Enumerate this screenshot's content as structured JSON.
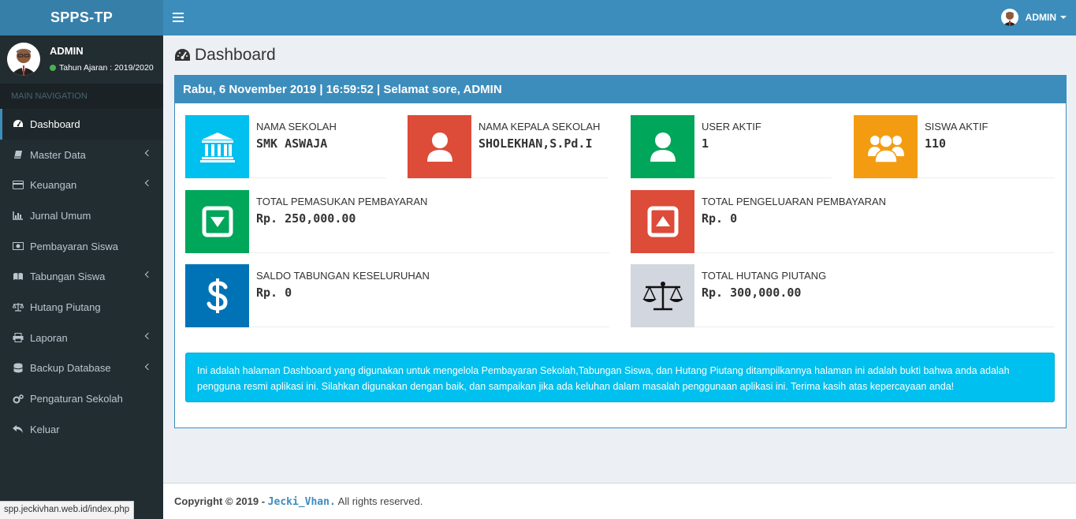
{
  "app": {
    "title": "SPPS-TP"
  },
  "header": {
    "user_label": "ADMIN"
  },
  "sidebar": {
    "user": {
      "name": "ADMIN",
      "year": "Tahun Ajaran : 2019/2020"
    },
    "nav_header": "MAIN NAVIGATION",
    "items": [
      {
        "label": "Dashboard",
        "icon": "dashboard-icon"
      },
      {
        "label": "Master Data",
        "icon": "book-icon"
      },
      {
        "label": "Keuangan",
        "icon": "credit-card-icon"
      },
      {
        "label": "Jurnal Umum",
        "icon": "bar-chart-icon"
      },
      {
        "label": "Pembayaran Siswa",
        "icon": "money-icon"
      },
      {
        "label": "Tabungan Siswa",
        "icon": "open-book-icon"
      },
      {
        "label": "Hutang Piutang",
        "icon": "balance-scale-icon"
      },
      {
        "label": "Laporan",
        "icon": "print-icon"
      },
      {
        "label": "Backup Database",
        "icon": "database-icon"
      },
      {
        "label": "Pengaturan Sekolah",
        "icon": "gears-icon"
      },
      {
        "label": "Keluar",
        "icon": "reply-icon"
      }
    ]
  },
  "page": {
    "title": "Dashboard",
    "box_header": "Rabu, 6 November 2019 | 16:59:52 | Selamat sore, ADMIN"
  },
  "cards": {
    "nama_sekolah": {
      "label": "NAMA SEKOLAH",
      "value": "SMK ASWAJA",
      "color": "#00c0ef"
    },
    "kepala_sekolah": {
      "label": "NAMA KEPALA SEKOLAH",
      "value": "SHOLEKHAN,S.Pd.I",
      "color": "#dd4b39"
    },
    "user_aktif": {
      "label": "USER AKTIF",
      "value": "1",
      "color": "#00a65a"
    },
    "siswa_aktif": {
      "label": "SISWA AKTIF",
      "value": "110",
      "color": "#f39c12"
    },
    "pemasukan": {
      "label": "TOTAL PEMASUKAN PEMBAYARAN",
      "value": "Rp. 250,000.00",
      "color": "#00a65a"
    },
    "pengeluaran": {
      "label": "TOTAL PENGELUARAN PEMBAYARAN",
      "value": "Rp. 0",
      "color": "#dd4b39"
    },
    "tabungan": {
      "label": "SALDO TABUNGAN KESELURUHAN",
      "value": "Rp. 0",
      "color": "#0073b7"
    },
    "hutang": {
      "label": "TOTAL HUTANG PIUTANG",
      "value": "Rp. 300,000.00",
      "color": "#d2d6de"
    }
  },
  "callout": "Ini adalah halaman Dashboard yang digunakan untuk mengelola Pembayaran Sekolah,Tabungan Siswa, dan Hutang Piutang ditampilkannya halaman ini adalah bukti bahwa anda adalah pengguna resmi aplikasi ini. Silahkan digunakan dengan baik, dan sampaikan jika ada keluhan dalam masalah penggunaan aplikasi ini. Terima kasih atas kepercayaan anda!",
  "footer": {
    "prefix": "Copyright © 2019 -",
    "author": "Jecki_Vhan.",
    "suffix": "All rights reserved."
  },
  "status_url": "spp.jeckivhan.web.id/index.php"
}
